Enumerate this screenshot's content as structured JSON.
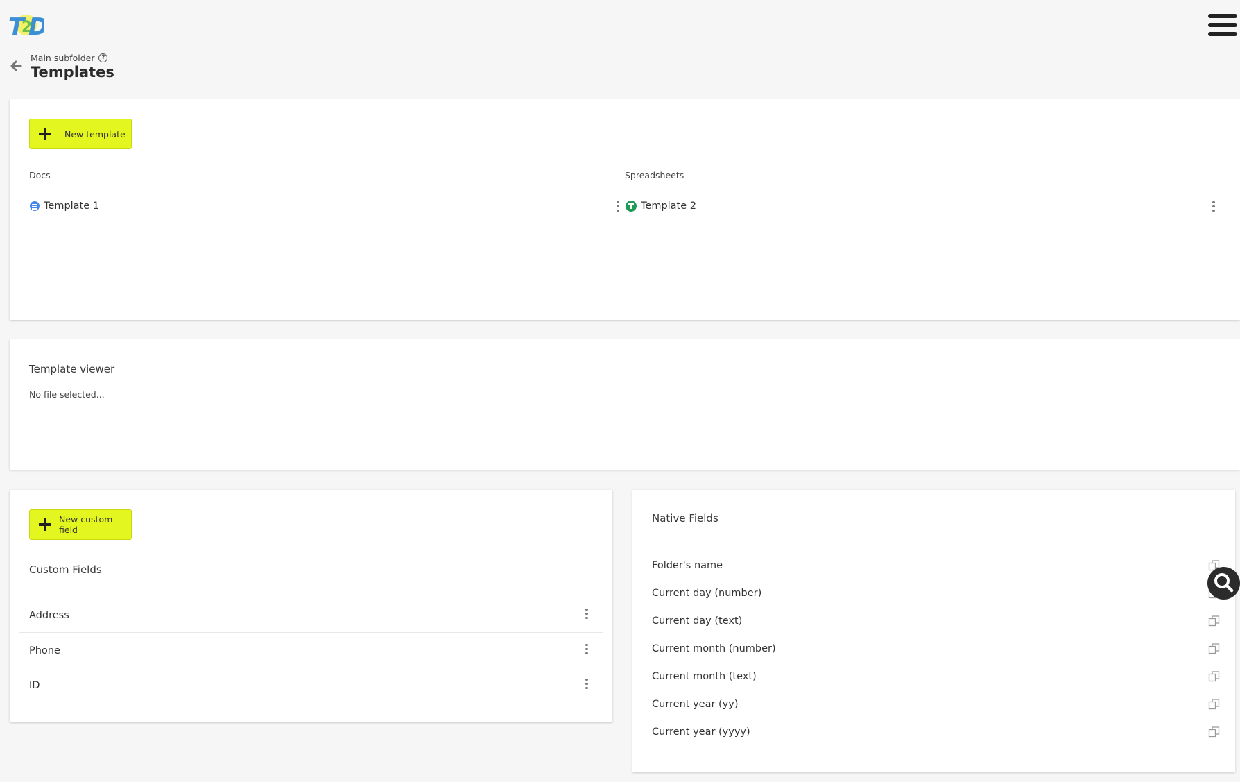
{
  "app": {
    "logo_text": "T2D"
  },
  "header": {
    "breadcrumb": "Main subfolder",
    "title": "Templates"
  },
  "templates": {
    "new_button_label": "New template",
    "docs_heading": "Docs",
    "spreadsheets_heading": "Spreadsheets",
    "docs": [
      {
        "name": "Template 1"
      }
    ],
    "spreadsheets": [
      {
        "name": "Template 2"
      }
    ]
  },
  "viewer": {
    "title": "Template viewer",
    "empty_text": "No file selected..."
  },
  "custom_fields": {
    "new_button_label": "New custom field",
    "title": "Custom Fields",
    "items": [
      {
        "label": "Address"
      },
      {
        "label": "Phone"
      },
      {
        "label": "ID"
      }
    ]
  },
  "native_fields": {
    "title": "Native Fields",
    "items": [
      {
        "label": "Folder's name"
      },
      {
        "label": "Current day (number)"
      },
      {
        "label": "Current day (text)"
      },
      {
        "label": "Current month (number)"
      },
      {
        "label": "Current month (text)"
      },
      {
        "label": "Current year (yy)"
      },
      {
        "label": "Current year (yyyy)"
      }
    ]
  },
  "colors": {
    "accent": "#e4f61f",
    "docs_icon": "#4a86e8",
    "sheets_icon": "#1e9b55"
  },
  "icons": [
    "menu-icon",
    "back-arrow-icon",
    "help-icon",
    "plus-icon",
    "doc-icon",
    "sheet-icon",
    "more-vertical-icon",
    "copy-icon",
    "search-icon"
  ]
}
